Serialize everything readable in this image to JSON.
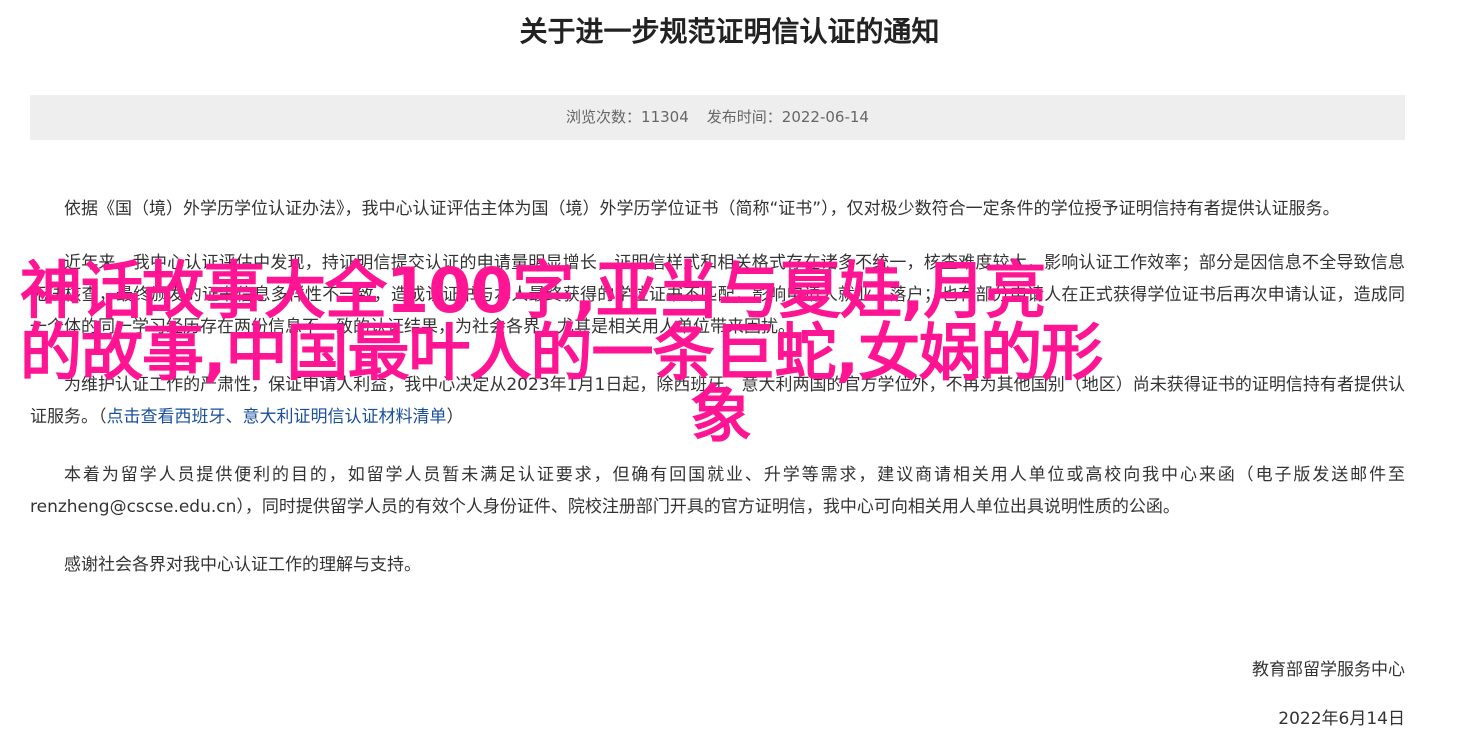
{
  "title": "关于进一步规范证明信认证的通知",
  "meta": {
    "views_label": "浏览次数：",
    "views_value": "11304",
    "published_label": "发布时间：",
    "published_value": "2022-06-14"
  },
  "paragraphs": {
    "p1": "依据《国（境）外学历学位认证办法》，我中心认证评估主体为国（境）外学历学位证书（简称“证书”），仅对极少数符合一定条件的学位授予证明信持有者提供认证服务。",
    "p2": "近年来，我中心认证评估中发现，持证明信提交认证的申请量明显增长，证明信样式和相关格式存在诸多不统一，核查难度较大，影响认证工作效率；部分是因信息不全导致信息无法核查，最终颁发的证书信息多样性不一致，造成认证书与本人最终获得的学位证书不匹配，影响申请人就业、落户；也有部分申请人在正式获得学位证书后再次申请认证，造成同一个体的同一学习经历存在两份信息不一致的认证结果，为社会各界，尤其是相关用人单位带来困扰。",
    "p3_text": "为维护认证工作的严肃性，保证申请人利益，我中心决定从2023年1月1日起，除西班牙、意大利两国的官方学位外，不再为其他国别（地区）尚未获得证书的证明信持有者提供认证服务。",
    "p3_link_open": "（",
    "p3_link": "点击查看西班牙、意大利证明信认证材料清单",
    "p3_link_close": "）",
    "p4": "本着为留学人员提供便利的目的，如留学人员暂未满足认证要求，但确有回国就业、升学等需求，建议商请相关用人单位或高校向我中心来函（电子版发送邮件至renzheng@cscse.edu.cn），同时提供留学人员的有效个人身份证件、院校注册部门开具的官方证明信，我中心可向相关用人单位出具说明性质的公函。",
    "p5": "感谢社会各界对我中心认证工作的理解与支持。"
  },
  "signature": {
    "org": "教育部留学服务中心",
    "date": "2022年6月14日"
  },
  "overlay": {
    "line1": "神话故事大全100字,亚当与夏娃,月亮",
    "line2": "的故事,中国最叶人的一条巨蛇,女娲的形",
    "line3": "象"
  },
  "colors": {
    "overlay": "#ff1493",
    "meta_bg": "#eeeeee",
    "link": "#1a4f9c"
  }
}
